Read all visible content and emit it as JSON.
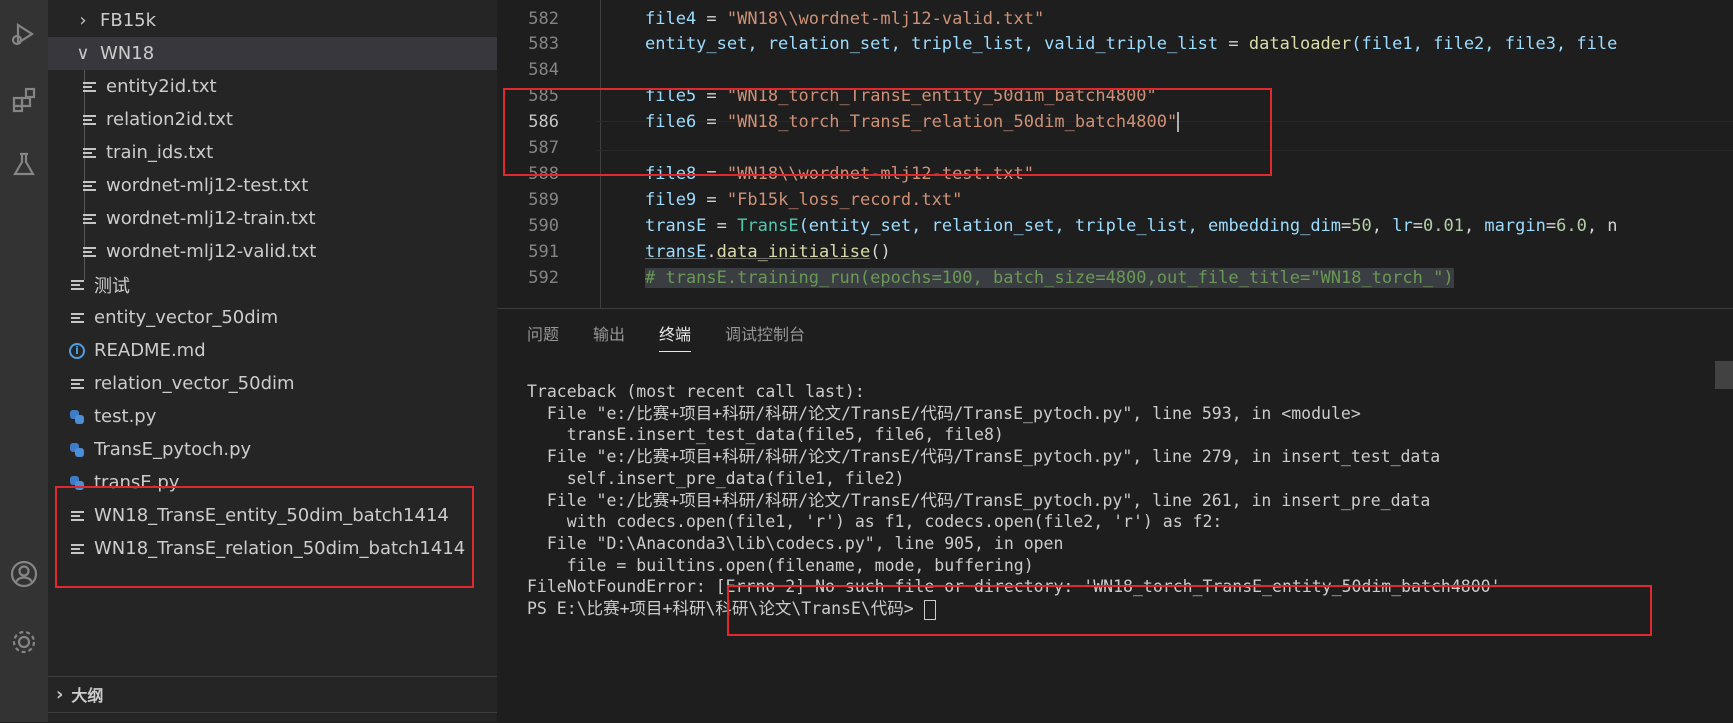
{
  "activity_bar": {
    "icons": [
      "run-debug-icon",
      "extensions-icon",
      "testing-icon",
      "account-icon",
      "settings-gear-icon"
    ]
  },
  "explorer": {
    "items": [
      {
        "label": "FB15k",
        "kind": "folder",
        "state": "collapsed"
      },
      {
        "label": "WN18",
        "kind": "folder",
        "state": "expanded"
      },
      {
        "label": "entity2id.txt",
        "kind": "file"
      },
      {
        "label": "relation2id.txt",
        "kind": "file"
      },
      {
        "label": "train_ids.txt",
        "kind": "file"
      },
      {
        "label": "wordnet-mlj12-test.txt",
        "kind": "file"
      },
      {
        "label": "wordnet-mlj12-train.txt",
        "kind": "file"
      },
      {
        "label": "wordnet-mlj12-valid.txt",
        "kind": "file"
      },
      {
        "label": "测试",
        "kind": "file"
      },
      {
        "label": "entity_vector_50dim",
        "kind": "file"
      },
      {
        "label": "README.md",
        "kind": "info"
      },
      {
        "label": "relation_vector_50dim",
        "kind": "file"
      },
      {
        "label": "test.py",
        "kind": "python"
      },
      {
        "label": "TransE_pytoch.py",
        "kind": "python"
      },
      {
        "label": "transE.py",
        "kind": "python"
      },
      {
        "label": "WN18_TransE_entity_50dim_batch1414",
        "kind": "file"
      },
      {
        "label": "WN18_TransE_relation_50dim_batch1414",
        "kind": "file"
      }
    ],
    "outline_label": "大纲"
  },
  "editor": {
    "line_numbers": [
      "582",
      "583",
      "584",
      "585",
      "586",
      "587",
      "588",
      "589",
      "590",
      "591",
      "592"
    ],
    "current_line": "586",
    "lines": {
      "l582": {
        "v": "file4",
        "op": " = ",
        "s": "\"WN18\\\\wordnet-mlj12-valid.txt\""
      },
      "l583": {
        "vars": "entity_set, relation_set, triple_list, valid_triple_list",
        "op": " = ",
        "fn": "dataloader",
        "args": "(file1, file2, file3, file"
      },
      "l585": {
        "v": "file5",
        "op": " = ",
        "s": "\"WN18_torch_TransE_entity_50dim_batch4800\""
      },
      "l586": {
        "v": "file6",
        "op": " = ",
        "s": "\"WN18_torch_TransE_relation_50dim_batch4800\""
      },
      "l588": {
        "v": "file8",
        "op": " = ",
        "s": "\"WN18\\\\wordnet-mlj12-test.txt\""
      },
      "l589": {
        "v": "file9",
        "op": " = ",
        "s": "\"Fb15k_loss_record.txt\""
      },
      "l590": {
        "v": "transE",
        "op": " = ",
        "cls": "TransE",
        "a1": "(entity_set, relation_set, triple_list, ",
        "k1": "embedding_dim",
        "n1": "50",
        "sep1": ", ",
        "k2": "lr",
        "n2": "0.01",
        "sep2": ", ",
        "k3": "margin",
        "n3": "6.0",
        "tail": ", n"
      },
      "l591": {
        "v": "transE",
        "dot": ".",
        "fn": "data_initialise",
        "tail": "()"
      },
      "l592": {
        "comment": "# transE.training_run(epochs=100, batch_size=4800,out_file_title=\"WN18_torch_\")"
      }
    }
  },
  "panel": {
    "tabs": [
      "问题",
      "输出",
      "终端",
      "调试控制台"
    ],
    "active_tab": "终端",
    "terminal_lines": [
      "Traceback (most recent call last):",
      "  File \"e:/比赛+项目+科研/科研/论文/TransE/代码/TransE_pytoch.py\", line 593, in <module>",
      "    transE.insert_test_data(file5, file6, file8)",
      "  File \"e:/比赛+项目+科研/科研/论文/TransE/代码/TransE_pytoch.py\", line 279, in insert_test_data",
      "    self.insert_pre_data(file1, file2)",
      "  File \"e:/比赛+项目+科研/科研/论文/TransE/代码/TransE_pytoch.py\", line 261, in insert_pre_data",
      "    with codecs.open(file1, 'r') as f1, codecs.open(file2, 'r') as f2:",
      "  File \"D:\\Anaconda3\\lib\\codecs.py\", line 905, in open",
      "    file = builtins.open(filename, mode, buffering)",
      "FileNotFoundError: [Errno 2] No such file or directory: 'WN18_torch_TransE_entity_50dim_batch4800'",
      "PS E:\\比赛+项目+科研\\科研\\论文\\TransE\\代码> "
    ]
  },
  "colors": {
    "highlight_box": "#e0282e",
    "activity_bar": "#333333",
    "sidebar": "#252526",
    "editor_bg": "#1e1e1e"
  }
}
